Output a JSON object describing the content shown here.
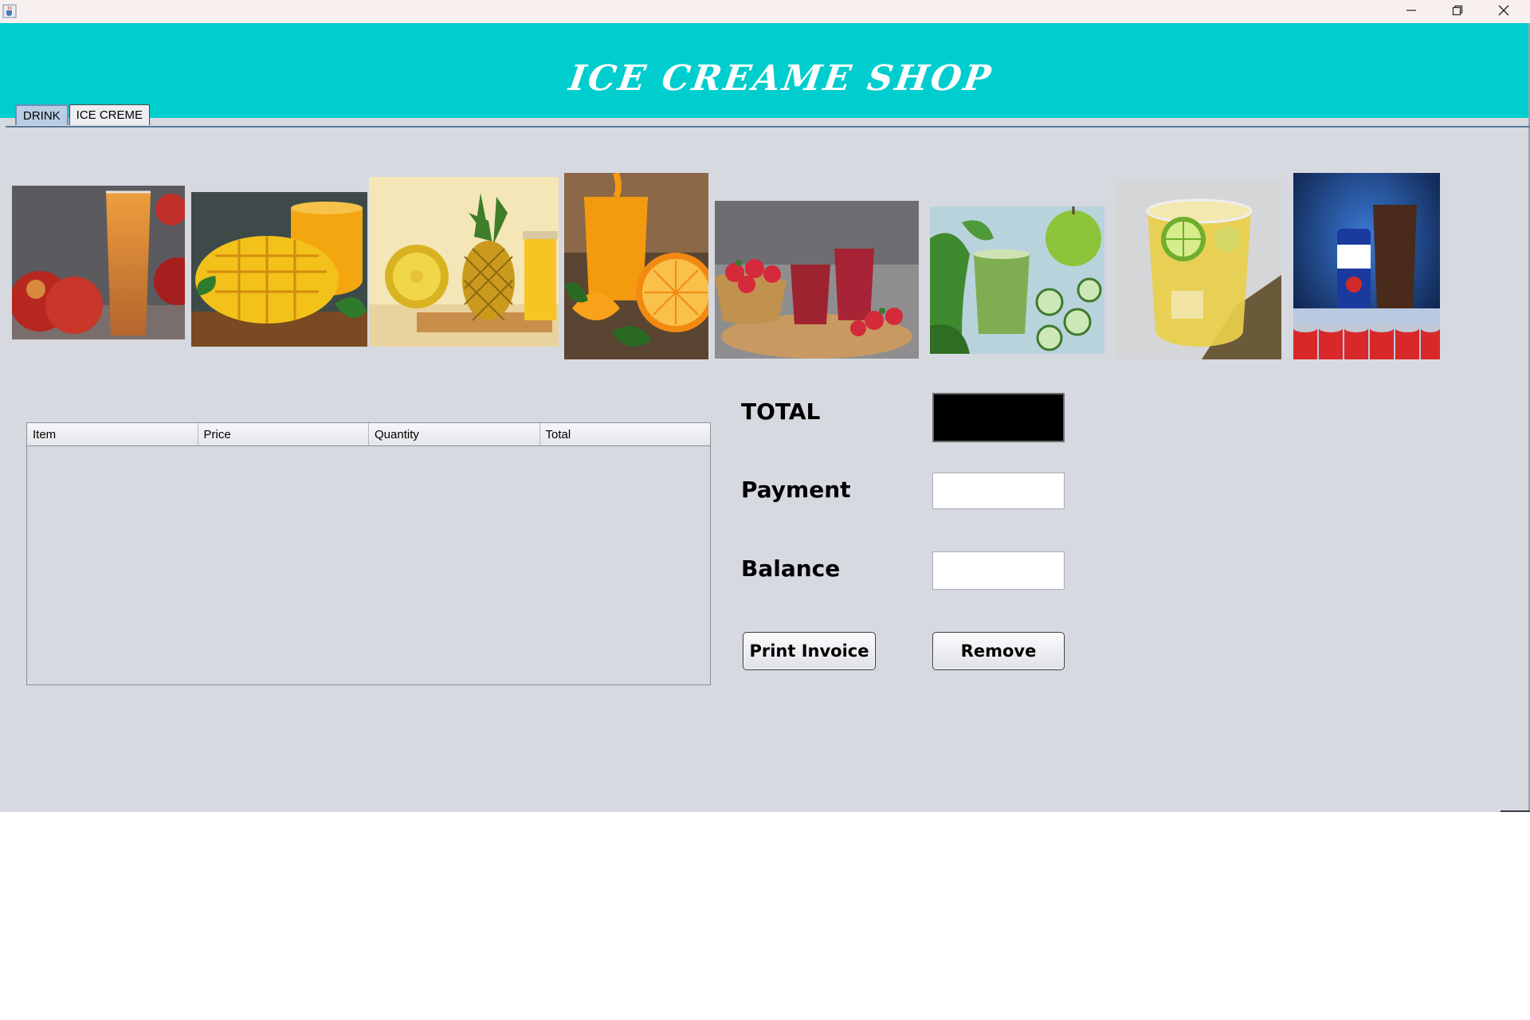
{
  "window": {
    "icons": {
      "app": "java-cup-icon",
      "minimize": "minimize-icon",
      "maximize": "restore-icon",
      "close": "close-icon"
    }
  },
  "header": {
    "title": "ICE CREAME SHOP",
    "background": "#00cdcd"
  },
  "tabs": [
    {
      "label": "DRINK",
      "active": true
    },
    {
      "label": "ICE CREME",
      "active": false
    }
  ],
  "products": [
    {
      "name": "apple-juice-image"
    },
    {
      "name": "mango-juice-image"
    },
    {
      "name": "pineapple-juice-image"
    },
    {
      "name": "orange-juice-image"
    },
    {
      "name": "strawberry-juice-image"
    },
    {
      "name": "green-juice-image"
    },
    {
      "name": "lime-drink-image"
    },
    {
      "name": "pepsi-image"
    }
  ],
  "table": {
    "columns": [
      "Item",
      "Price",
      "Quantity",
      "Total"
    ],
    "rows": []
  },
  "form": {
    "total_label": "TOTAL",
    "payment_label": "Payment",
    "balance_label": "Balance",
    "total_value": "",
    "payment_value": "",
    "balance_value": "",
    "print_button": "Print Invoice",
    "remove_button": "Remove"
  }
}
